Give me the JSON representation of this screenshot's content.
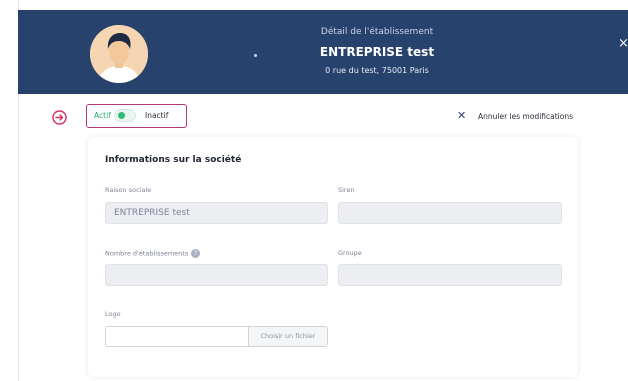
{
  "header": {
    "subtitle": "Détail de l'établissement",
    "title": "ENTREPRISE test",
    "address": "0 rue du test, 75001 Paris",
    "close_icon": "close-icon"
  },
  "status_toggle": {
    "active_label": "Actif",
    "inactive_label": "Inactif",
    "value": "Actif"
  },
  "actions": {
    "cancel_label": "Annuler les modifications"
  },
  "company_section": {
    "title": "Informations sur la société",
    "fields": {
      "raison_sociale": {
        "label": "Raison sociale",
        "value": "ENTREPRISE test"
      },
      "siren": {
        "label": "Siren",
        "value": ""
      },
      "nombre_etablissements": {
        "label": "Nombre d'établissements",
        "help": "?",
        "value": ""
      },
      "groupe": {
        "label": "Groupe",
        "value": ""
      },
      "logo": {
        "label": "Logo",
        "button_label": "Choisir un fichier"
      }
    }
  },
  "colors": {
    "header_bg": "#27426d",
    "highlight_border": "#b23a7a",
    "active_green": "#2dbb79"
  }
}
